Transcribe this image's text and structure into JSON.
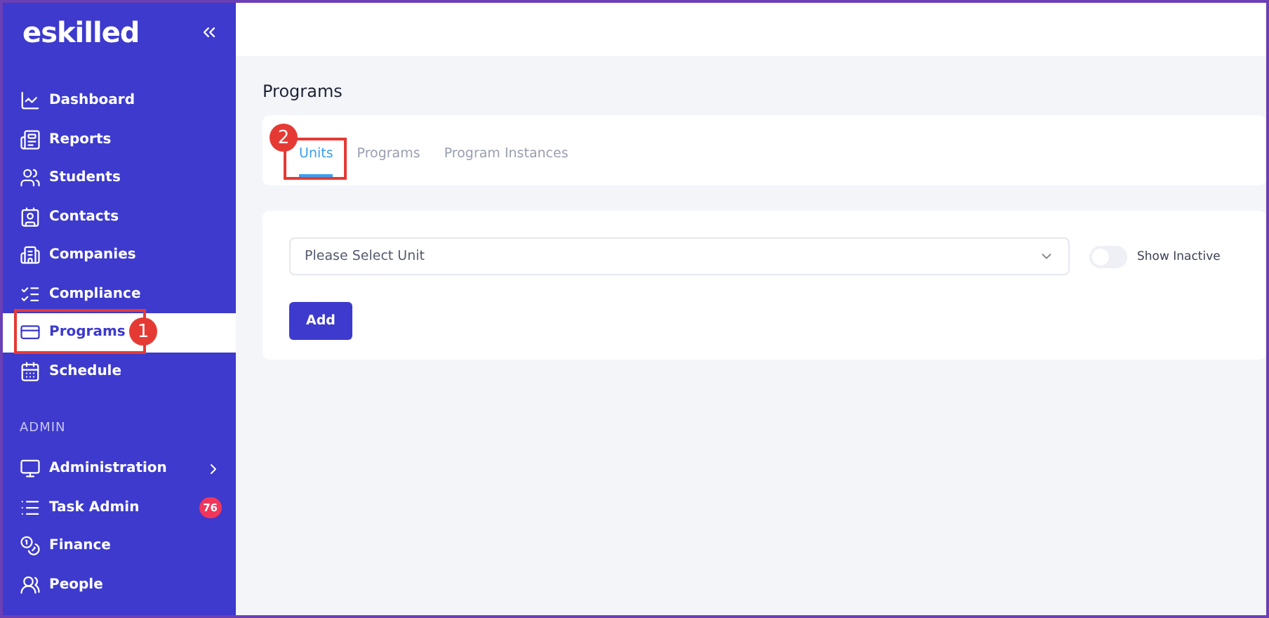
{
  "sidebar": {
    "logo": "eskilled",
    "items": [
      {
        "label": "Dashboard",
        "selected": false
      },
      {
        "label": "Reports",
        "selected": false
      },
      {
        "label": "Students",
        "selected": false
      },
      {
        "label": "Contacts",
        "selected": false
      },
      {
        "label": "Companies",
        "selected": false
      },
      {
        "label": "Compliance",
        "selected": false
      },
      {
        "label": "Programs",
        "selected": true,
        "callout": "1"
      },
      {
        "label": "Schedule",
        "selected": false
      }
    ],
    "section": "ADMIN",
    "admin_items": [
      {
        "label": "Administration",
        "expandable": true
      },
      {
        "label": "Task Admin",
        "badge": "76"
      },
      {
        "label": "Finance"
      },
      {
        "label": "People"
      }
    ]
  },
  "page": {
    "title": "Programs",
    "tabs": [
      {
        "label": "Units",
        "selected": true,
        "callout": "2"
      },
      {
        "label": "Programs",
        "selected": false
      },
      {
        "label": "Program Instances",
        "selected": false
      }
    ],
    "select": {
      "placeholder": "Please Select Unit"
    },
    "toggle": {
      "label": "Show Inactive",
      "on": false
    },
    "button": "Add"
  }
}
